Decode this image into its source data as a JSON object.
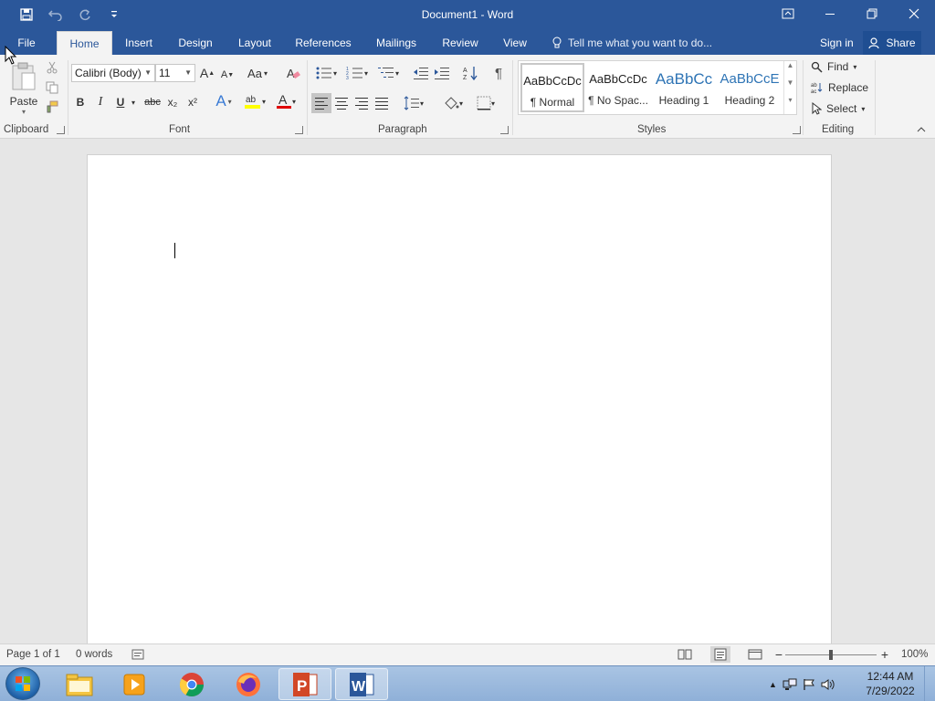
{
  "window": {
    "title": "Document1 - Word"
  },
  "tabs": {
    "file": "File",
    "home": "Home",
    "insert": "Insert",
    "design": "Design",
    "layout": "Layout",
    "references": "References",
    "mailings": "Mailings",
    "review": "Review",
    "view": "View"
  },
  "tellme": {
    "placeholder": "Tell me what you want to do..."
  },
  "account": {
    "signin": "Sign in",
    "share": "Share"
  },
  "clipboard": {
    "paste": "Paste",
    "label": "Clipboard"
  },
  "font": {
    "name": "Calibri (Body)",
    "size": "11",
    "label": "Font",
    "bold": "B",
    "italic": "I",
    "underline": "U",
    "strike": "abc",
    "subscript": "x₂",
    "superscript": "x²",
    "grow": "A",
    "shrink": "A",
    "case": "Aa",
    "effects": "A",
    "color": "A"
  },
  "paragraph": {
    "label": "Paragraph",
    "pilcrow": "¶"
  },
  "styles": {
    "label": "Styles",
    "items": [
      {
        "sample": "AaBbCcDc",
        "name": "¶ Normal"
      },
      {
        "sample": "AaBbCcDc",
        "name": "¶ No Spac..."
      },
      {
        "sample": "AaBbCc",
        "name": "Heading 1"
      },
      {
        "sample": "AaBbCcE",
        "name": "Heading 2"
      }
    ]
  },
  "editing": {
    "label": "Editing",
    "find": "Find",
    "replace": "Replace",
    "select": "Select"
  },
  "status": {
    "page": "Page 1 of 1",
    "words": "0 words",
    "zoom": "100%"
  },
  "clock": {
    "time": "12:44 AM",
    "date": "7/29/2022"
  },
  "colors": {
    "accent": "#2b579a",
    "highlight": "#ffff00",
    "font_color": "#e00000"
  }
}
